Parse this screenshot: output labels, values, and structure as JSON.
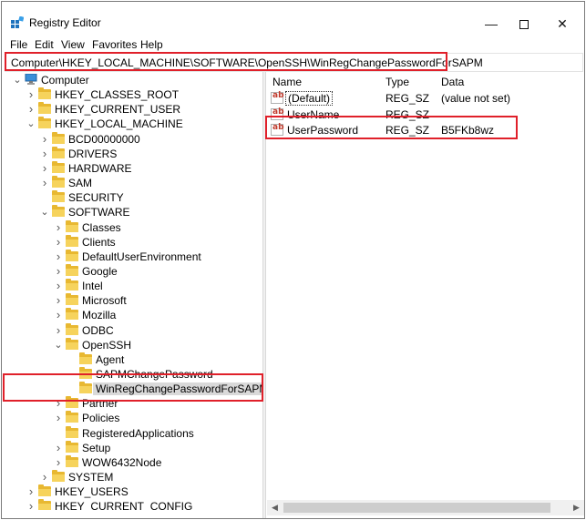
{
  "window": {
    "title": "Registry Editor",
    "icon": "registry-editor-icon",
    "controls": {
      "minimize": "—",
      "close": "✕"
    }
  },
  "menu": [
    "File",
    "Edit",
    "View",
    "Favorites",
    "Help"
  ],
  "address": "Computer\\HKEY_LOCAL_MACHINE\\SOFTWARE\\OpenSSH\\WinRegChangePasswordForSAPM",
  "tree": [
    {
      "label": "Computer",
      "level": 0,
      "state": "expanded",
      "icon": "computer-icon"
    },
    {
      "label": "HKEY_CLASSES_ROOT",
      "level": 1,
      "state": "collapsed"
    },
    {
      "label": "HKEY_CURRENT_USER",
      "level": 1,
      "state": "collapsed"
    },
    {
      "label": "HKEY_LOCAL_MACHINE",
      "level": 1,
      "state": "expanded"
    },
    {
      "label": "BCD00000000",
      "level": 2,
      "state": "collapsed"
    },
    {
      "label": "DRIVERS",
      "level": 2,
      "state": "collapsed"
    },
    {
      "label": "HARDWARE",
      "level": 2,
      "state": "collapsed"
    },
    {
      "label": "SAM",
      "level": 2,
      "state": "collapsed"
    },
    {
      "label": "SECURITY",
      "level": 2,
      "state": "none"
    },
    {
      "label": "SOFTWARE",
      "level": 2,
      "state": "expanded"
    },
    {
      "label": "Classes",
      "level": 3,
      "state": "collapsed"
    },
    {
      "label": "Clients",
      "level": 3,
      "state": "collapsed"
    },
    {
      "label": "DefaultUserEnvironment",
      "level": 3,
      "state": "collapsed"
    },
    {
      "label": "Google",
      "level": 3,
      "state": "collapsed"
    },
    {
      "label": "Intel",
      "level": 3,
      "state": "collapsed"
    },
    {
      "label": "Microsoft",
      "level": 3,
      "state": "collapsed"
    },
    {
      "label": "Mozilla",
      "level": 3,
      "state": "collapsed"
    },
    {
      "label": "ODBC",
      "level": 3,
      "state": "collapsed"
    },
    {
      "label": "OpenSSH",
      "level": 3,
      "state": "expanded"
    },
    {
      "label": "Agent",
      "level": 4,
      "state": "none"
    },
    {
      "label": "SAPMChangePassword",
      "level": 4,
      "state": "none"
    },
    {
      "label": "WinRegChangePasswordForSAPM",
      "level": 4,
      "state": "none",
      "selected": true
    },
    {
      "label": "Partner",
      "level": 3,
      "state": "collapsed"
    },
    {
      "label": "Policies",
      "level": 3,
      "state": "collapsed"
    },
    {
      "label": "RegisteredApplications",
      "level": 3,
      "state": "none"
    },
    {
      "label": "Setup",
      "level": 3,
      "state": "collapsed"
    },
    {
      "label": "WOW6432Node",
      "level": 3,
      "state": "collapsed"
    },
    {
      "label": "SYSTEM",
      "level": 2,
      "state": "collapsed"
    },
    {
      "label": "HKEY_USERS",
      "level": 1,
      "state": "collapsed"
    },
    {
      "label": "HKEY_CURRENT_CONFIG",
      "level": 1,
      "state": "collapsed"
    }
  ],
  "columns": {
    "name": "Name",
    "type": "Type",
    "data": "Data"
  },
  "values": [
    {
      "name": "(Default)",
      "type": "REG_SZ",
      "data": "(value not set)",
      "icon": "string-value-icon"
    },
    {
      "name": "UserName",
      "type": "REG_SZ",
      "data": "",
      "icon": "string-value-icon"
    },
    {
      "name": "UserPassword",
      "type": "REG_SZ",
      "data": "B5FKb8wz",
      "icon": "string-value-icon"
    }
  ],
  "colors": {
    "highlight_box": "#e0202a",
    "selection": "#d9d9d9",
    "folder": "#e8b831"
  }
}
